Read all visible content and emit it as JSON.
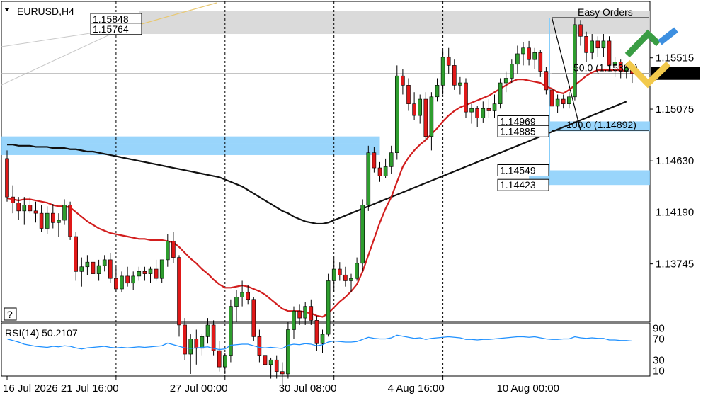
{
  "chart_data": {
    "type": "candlestick",
    "symbol_timeframe": "EURUSD,H4",
    "indicator_label": "RSI(14) 50.2107",
    "price_axis": {
      "range": [
        1.1325,
        1.16
      ],
      "ticks": [
        "1.15515",
        "1.15075",
        "1.14630",
        "1.14190",
        "1.13745"
      ],
      "current_price": "1.15381"
    },
    "rsi_axis": {
      "range": [
        0,
        100
      ],
      "ticks": [
        "90",
        "70",
        "30",
        "10"
      ]
    },
    "time_axis": {
      "ticks": [
        "16 Jul 2026",
        "21 Jul 16:00",
        "27 Jul 00:00",
        "30 Jul 08:00",
        "4 Aug 16:00",
        "10 Aug 00:00"
      ],
      "tick_bars": [
        0,
        19,
        38,
        57,
        76,
        95
      ]
    },
    "price_labels": [
      "1.15848",
      "1.15764",
      "1.14969",
      "1.14885",
      "1.14549",
      "1.14423"
    ],
    "fib_labels": [
      "50.0 (1.15381)",
      "100.0 (1.14892)"
    ],
    "watermark_text": "Easy Orders",
    "help_button": "?",
    "zones": [
      {
        "top": 1.1592,
        "bottom": 1.1572,
        "from_bar": 24,
        "to_bar": 120,
        "color": "#d3d3d3"
      },
      {
        "top": 1.1484,
        "bottom": 1.1478,
        "from_bar": 0,
        "to_bar": 65,
        "color": "#87cefa"
      },
      {
        "top": 1.1478,
        "bottom": 1.1468,
        "from_bar": 0,
        "to_bar": 65,
        "color": "#87cefa"
      },
      {
        "top": 1.14969,
        "bottom": 1.14885,
        "from_bar": 92,
        "to_bar": 120,
        "color": "#87cefa"
      },
      {
        "top": 1.14549,
        "bottom": 1.14423,
        "from_bar": 92,
        "to_bar": 120,
        "color": "#87cefa"
      }
    ],
    "candles": [
      [
        1.1465,
        1.1472,
        1.1428,
        1.1432
      ],
      [
        1.1432,
        1.1442,
        1.1418,
        1.1427
      ],
      [
        1.1427,
        1.1432,
        1.1412,
        1.142
      ],
      [
        1.142,
        1.1432,
        1.1408,
        1.1425
      ],
      [
        1.1425,
        1.1432,
        1.1418,
        1.142
      ],
      [
        1.142,
        1.1428,
        1.141,
        1.1418
      ],
      [
        1.1418,
        1.1425,
        1.1402,
        1.1405
      ],
      [
        1.1405,
        1.1424,
        1.14,
        1.1418
      ],
      [
        1.1418,
        1.1426,
        1.1405,
        1.141
      ],
      [
        1.141,
        1.1418,
        1.1398,
        1.1412
      ],
      [
        1.1412,
        1.143,
        1.1408,
        1.1425
      ],
      [
        1.1425,
        1.1428,
        1.1395,
        1.1398
      ],
      [
        1.1398,
        1.1402,
        1.136,
        1.1368
      ],
      [
        1.1368,
        1.138,
        1.1355,
        1.1372
      ],
      [
        1.1372,
        1.1382,
        1.1365,
        1.1376
      ],
      [
        1.1376,
        1.1382,
        1.1362,
        1.1366
      ],
      [
        1.1366,
        1.1378,
        1.136,
        1.1373
      ],
      [
        1.1373,
        1.1382,
        1.1368,
        1.1378
      ],
      [
        1.1378,
        1.1384,
        1.1358,
        1.1362
      ],
      [
        1.1362,
        1.1372,
        1.135,
        1.1353
      ],
      [
        1.1353,
        1.1368,
        1.135,
        1.1364
      ],
      [
        1.1364,
        1.1372,
        1.1355,
        1.1358
      ],
      [
        1.1358,
        1.1368,
        1.1352,
        1.1364
      ],
      [
        1.1364,
        1.1372,
        1.136,
        1.1368
      ],
      [
        1.1368,
        1.1372,
        1.136,
        1.1366
      ],
      [
        1.1366,
        1.1372,
        1.1358,
        1.137
      ],
      [
        1.137,
        1.1378,
        1.136,
        1.1362
      ],
      [
        1.1362,
        1.1378,
        1.1358,
        1.1378
      ],
      [
        1.1378,
        1.14,
        1.1372,
        1.1394
      ],
      [
        1.1394,
        1.1402,
        1.1375,
        1.138
      ],
      [
        1.138,
        1.1382,
        1.1312,
        1.1322
      ],
      [
        1.1322,
        1.1328,
        1.1292,
        1.1297
      ],
      [
        1.1297,
        1.1314,
        1.128,
        1.131
      ],
      [
        1.131,
        1.1318,
        1.1288,
        1.1302
      ],
      [
        1.1302,
        1.1314,
        1.1296,
        1.1312
      ],
      [
        1.1312,
        1.1328,
        1.1306,
        1.1322
      ],
      [
        1.1322,
        1.1326,
        1.1296,
        1.13
      ],
      [
        1.13,
        1.1308,
        1.1282,
        1.1286
      ],
      [
        1.1286,
        1.1298,
        1.128,
        1.1296
      ],
      [
        1.1296,
        1.1344,
        1.129,
        1.1338
      ],
      [
        1.1338,
        1.1352,
        1.1325,
        1.1346
      ],
      [
        1.1346,
        1.136,
        1.1338,
        1.135
      ],
      [
        1.135,
        1.1356,
        1.134,
        1.1344
      ],
      [
        1.1344,
        1.1346,
        1.1308,
        1.1312
      ],
      [
        1.1312,
        1.1318,
        1.129,
        1.1296
      ],
      [
        1.1296,
        1.13,
        1.1282,
        1.1288
      ],
      [
        1.1288,
        1.1294,
        1.1276,
        1.1292
      ],
      [
        1.1292,
        1.1296,
        1.1276,
        1.1282
      ],
      [
        1.1282,
        1.129,
        1.127,
        1.128
      ],
      [
        1.128,
        1.1325,
        1.1276,
        1.1318
      ],
      [
        1.1318,
        1.1338,
        1.131,
        1.1334
      ],
      [
        1.1334,
        1.134,
        1.1322,
        1.1328
      ],
      [
        1.1328,
        1.1342,
        1.1322,
        1.1338
      ],
      [
        1.1338,
        1.1344,
        1.1322,
        1.1326
      ],
      [
        1.1326,
        1.133,
        1.13,
        1.1306
      ],
      [
        1.1306,
        1.1318,
        1.1298,
        1.1314
      ],
      [
        1.1314,
        1.1366,
        1.1312,
        1.136
      ],
      [
        1.136,
        1.138,
        1.135,
        1.137
      ],
      [
        1.137,
        1.1376,
        1.136,
        1.1365
      ],
      [
        1.1365,
        1.1372,
        1.1355,
        1.136
      ],
      [
        1.136,
        1.1366,
        1.135,
        1.1362
      ],
      [
        1.1362,
        1.138,
        1.136,
        1.1375
      ],
      [
        1.1375,
        1.143,
        1.1368,
        1.1425
      ],
      [
        1.1425,
        1.1476,
        1.142,
        1.147
      ],
      [
        1.147,
        1.1475,
        1.1453,
        1.1457
      ],
      [
        1.1457,
        1.1462,
        1.1445,
        1.145
      ],
      [
        1.145,
        1.1465,
        1.1448,
        1.1458
      ],
      [
        1.1458,
        1.1476,
        1.1452,
        1.147
      ],
      [
        1.147,
        1.1545,
        1.1464,
        1.1536
      ],
      [
        1.1536,
        1.1542,
        1.152,
        1.1528
      ],
      [
        1.1528,
        1.1534,
        1.1506,
        1.1512
      ],
      [
        1.1512,
        1.1522,
        1.1498,
        1.1502
      ],
      [
        1.1502,
        1.152,
        1.1495,
        1.1516
      ],
      [
        1.1516,
        1.1522,
        1.148,
        1.1484
      ],
      [
        1.1484,
        1.1522,
        1.1472,
        1.1518
      ],
      [
        1.1518,
        1.1534,
        1.1514,
        1.1528
      ],
      [
        1.1528,
        1.1558,
        1.152,
        1.1552
      ],
      [
        1.1552,
        1.156,
        1.1538,
        1.1545
      ],
      [
        1.1545,
        1.155,
        1.1524,
        1.1528
      ],
      [
        1.1528,
        1.1535,
        1.152,
        1.153
      ],
      [
        1.153,
        1.1534,
        1.15,
        1.1505
      ],
      [
        1.1505,
        1.1512,
        1.1495,
        1.1508
      ],
      [
        1.1508,
        1.151,
        1.1492,
        1.15
      ],
      [
        1.15,
        1.1514,
        1.1496,
        1.1508
      ],
      [
        1.1508,
        1.1516,
        1.15,
        1.1506
      ],
      [
        1.1506,
        1.152,
        1.15,
        1.1512
      ],
      [
        1.1512,
        1.1534,
        1.1508,
        1.153
      ],
      [
        1.153,
        1.154,
        1.1522,
        1.1534
      ],
      [
        1.1534,
        1.155,
        1.153,
        1.1546
      ],
      [
        1.1546,
        1.1562,
        1.1538,
        1.1555
      ],
      [
        1.1555,
        1.1565,
        1.1545,
        1.156
      ],
      [
        1.156,
        1.1566,
        1.1545,
        1.155
      ],
      [
        1.155,
        1.156,
        1.1542,
        1.1556
      ],
      [
        1.1556,
        1.1558,
        1.1535,
        1.154
      ],
      [
        1.154,
        1.1544,
        1.152,
        1.1524
      ],
      [
        1.1524,
        1.1528,
        1.1505,
        1.151
      ],
      [
        1.151,
        1.152,
        1.1504,
        1.1516
      ],
      [
        1.1516,
        1.152,
        1.1508,
        1.1512
      ],
      [
        1.1512,
        1.1522,
        1.1508,
        1.1518
      ],
      [
        1.1518,
        1.1586,
        1.1515,
        1.158
      ],
      [
        1.158,
        1.1584,
        1.1562,
        1.157
      ],
      [
        1.157,
        1.1574,
        1.1548,
        1.1556
      ],
      [
        1.1556,
        1.1572,
        1.155,
        1.1566
      ],
      [
        1.1566,
        1.157,
        1.1552,
        1.156
      ],
      [
        1.156,
        1.1572,
        1.1552,
        1.1566
      ],
      [
        1.1566,
        1.157,
        1.154,
        1.1545
      ],
      [
        1.1545,
        1.1552,
        1.1535,
        1.1548
      ],
      [
        1.1548,
        1.155,
        1.1534,
        1.154
      ],
      [
        1.154,
        1.1547,
        1.1534,
        1.1544
      ],
      [
        1.1544,
        1.1547,
        1.153,
        1.1538
      ]
    ],
    "ma_red": [
      1.1431,
      1.143,
      1.1429,
      1.143,
      1.143,
      1.1429,
      1.1428,
      1.1427,
      1.1425,
      1.1424,
      1.1424,
      1.1423,
      1.1419,
      1.1415,
      1.1411,
      1.1408,
      1.1405,
      1.1403,
      1.1401,
      1.14,
      1.1399,
      1.1398,
      1.1397,
      1.1396,
      1.1396,
      1.1395,
      1.1395,
      1.1395,
      1.1394,
      1.1393,
      1.1389,
      1.1384,
      1.1379,
      1.1375,
      1.137,
      1.1366,
      1.1361,
      1.1357,
      1.1354,
      1.1354,
      1.1355,
      1.1356,
      1.1355,
      1.1353,
      1.1351,
      1.1348,
      1.1344,
      1.134,
      1.1336,
      1.1334,
      1.1334,
      1.1334,
      1.1333,
      1.1332,
      1.133,
      1.1329,
      1.1332,
      1.1337,
      1.1342,
      1.1346,
      1.1351,
      1.1357,
      1.1368,
      1.1382,
      1.1396,
      1.141,
      1.1422,
      1.1432,
      1.1445,
      1.1458,
      1.1466,
      1.1472,
      1.1477,
      1.1481,
      1.1486,
      1.1491,
      1.1497,
      1.1502,
      1.1506,
      1.1509,
      1.1511,
      1.1513,
      1.1515,
      1.1517,
      1.1519,
      1.1522,
      1.1525,
      1.1528,
      1.1531,
      1.1533,
      1.1533,
      1.1532,
      1.1531,
      1.153,
      1.1527,
      1.1525,
      1.1522,
      1.1521,
      1.1524,
      1.1528,
      1.1532,
      1.1536,
      1.1539,
      1.1541,
      1.1541,
      1.1541,
      1.1541,
      1.1541,
      1.154
    ],
    "ma_black": [
      1.1477,
      1.1477,
      1.1476,
      1.1476,
      1.1476,
      1.1475,
      1.1475,
      1.1475,
      1.1474,
      1.1474,
      1.1474,
      1.1473,
      1.1473,
      1.1472,
      1.1471,
      1.1471,
      1.147,
      1.1469,
      1.1468,
      1.1467,
      1.1466,
      1.1465,
      1.1464,
      1.1463,
      1.1462,
      1.1461,
      1.146,
      1.1459,
      1.1458,
      1.1457,
      1.1456,
      1.1455,
      1.1454,
      1.1453,
      1.1452,
      1.1451,
      1.145,
      1.1449,
      1.1447,
      1.1445,
      1.1443,
      1.1441,
      1.1438,
      1.1435,
      1.1432,
      1.1429,
      1.1426,
      1.1423,
      1.142,
      1.1418,
      1.1415,
      1.1413,
      1.1411,
      1.141,
      1.1409,
      1.1409,
      1.141,
      1.1412,
      1.1414,
      1.1416,
      1.1418,
      1.142,
      1.1422,
      1.1424,
      1.1426,
      1.1428,
      1.143,
      1.1432,
      1.1434,
      1.1436,
      1.1438,
      1.144,
      1.1442,
      1.1444,
      1.1446,
      1.1448,
      1.145,
      1.1452,
      1.1454,
      1.1456,
      1.1458,
      1.146,
      1.1462,
      1.1464,
      1.1466,
      1.1468,
      1.147,
      1.1472,
      1.1474,
      1.1476,
      1.1478,
      1.148,
      1.1482,
      1.1484,
      1.1486,
      1.1488,
      1.149,
      1.1492,
      1.1494,
      1.1496,
      1.1498,
      1.15,
      1.1502,
      1.1504,
      1.1506,
      1.1508,
      1.151,
      1.1512,
      1.1514
    ],
    "rsi": [
      70,
      67,
      64,
      60,
      58,
      56,
      55,
      54,
      56,
      55,
      57,
      56,
      53,
      51,
      53,
      54,
      55,
      56,
      54,
      53,
      54,
      53,
      54,
      55,
      54,
      55,
      56,
      57,
      62,
      59,
      56,
      53,
      52,
      53,
      54,
      55,
      52,
      50,
      51,
      58,
      59,
      60,
      60,
      57,
      54,
      53,
      54,
      53,
      52,
      58,
      60,
      59,
      61,
      60,
      57,
      59,
      64,
      66,
      65,
      64,
      64,
      65,
      69,
      73,
      71,
      70,
      70,
      72,
      77,
      75,
      73,
      71,
      72,
      69,
      71,
      72,
      73,
      74,
      73,
      72,
      69,
      69,
      68,
      69,
      69,
      70,
      71,
      72,
      73,
      74,
      74,
      73,
      74,
      72,
      70,
      69,
      69,
      70,
      70,
      74,
      72,
      71,
      72,
      71,
      71,
      68,
      68,
      67,
      67,
      66
    ]
  }
}
